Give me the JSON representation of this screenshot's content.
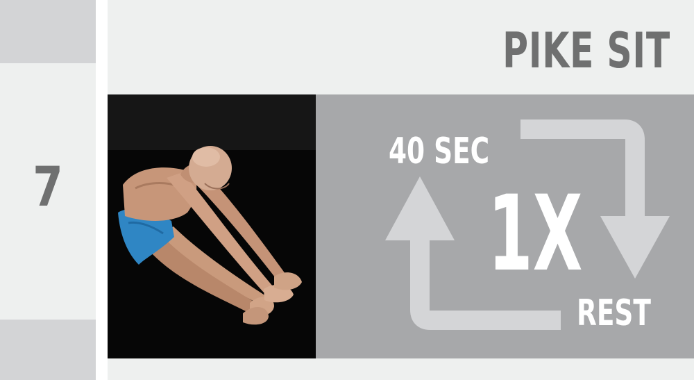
{
  "sidebar": {
    "step_number": "7"
  },
  "exercise": {
    "title": "PIKE SIT",
    "photo_subject": "person-seated-forward-fold"
  },
  "routine": {
    "duration": "40 SEC",
    "repetitions": "1X",
    "rest": "REST"
  },
  "icons": {
    "cycle": "cycle-arrows-icon"
  },
  "colors": {
    "page_background": "#eef0ef",
    "sidebar_block": "#d3d4d6",
    "text_gray": "#6f7070",
    "info_panel": "#a7a8aa",
    "arrow_light": "#d4d5d7",
    "info_text": "#ffffff",
    "photo_background": "#0b0b0b",
    "shorts_blue": "#2f86c4"
  }
}
